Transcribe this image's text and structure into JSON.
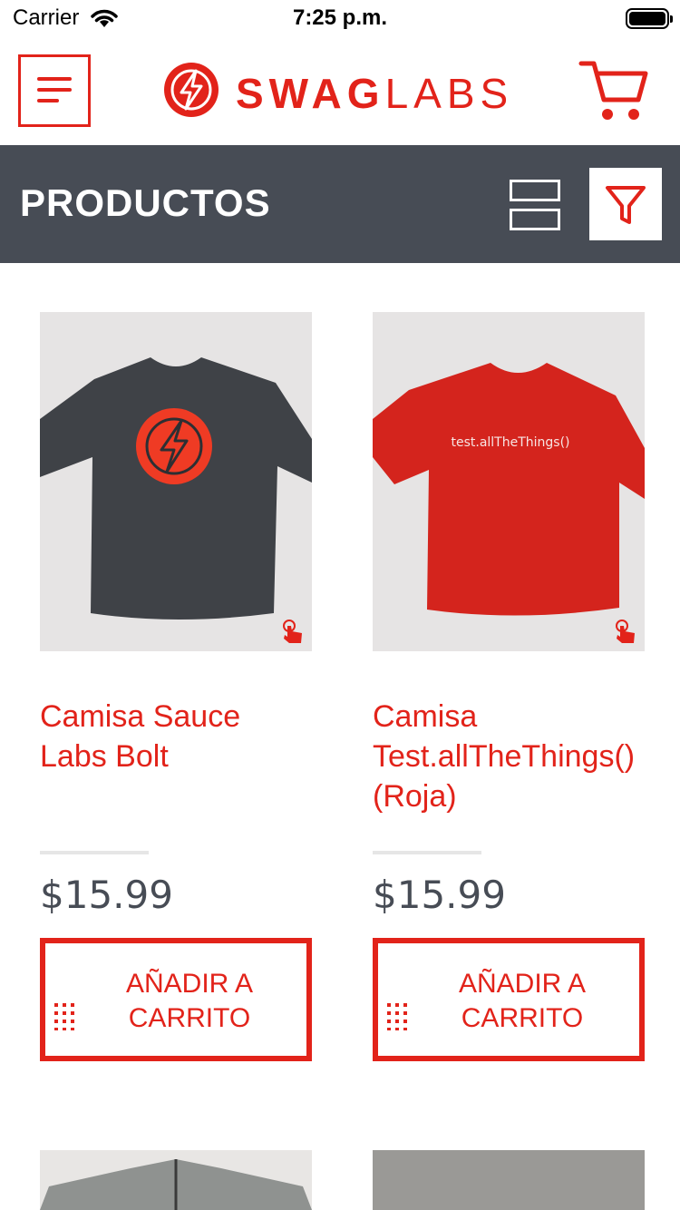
{
  "status_bar": {
    "carrier": "Carrier",
    "time": "7:25 p.m."
  },
  "header": {
    "logo_bold": "SWAG",
    "logo_light": "LABS"
  },
  "toolbar": {
    "title": "PRODUCTOS"
  },
  "products": [
    {
      "name": "Camisa Sauce Labs Bolt",
      "price": "$15.99",
      "add_label": "AÑADIR A\nCARRITO",
      "shirt_color": "#3f4247",
      "print_text": ""
    },
    {
      "name": "Camisa Test.allTheThings() (Roja)",
      "price": "$15.99",
      "add_label": "AÑADIR A\nCARRITO",
      "shirt_color": "#d4241d",
      "print_text": "test.allTheThings()"
    }
  ],
  "colors": {
    "accent": "#e2231a",
    "bar": "#474c55"
  },
  "icons": [
    "wifi-icon",
    "battery-icon",
    "menu-icon",
    "swaglabs-logo-icon",
    "cart-icon",
    "toggle-view-icon",
    "filter-icon",
    "tap-icon",
    "drag-handle-icon"
  ]
}
